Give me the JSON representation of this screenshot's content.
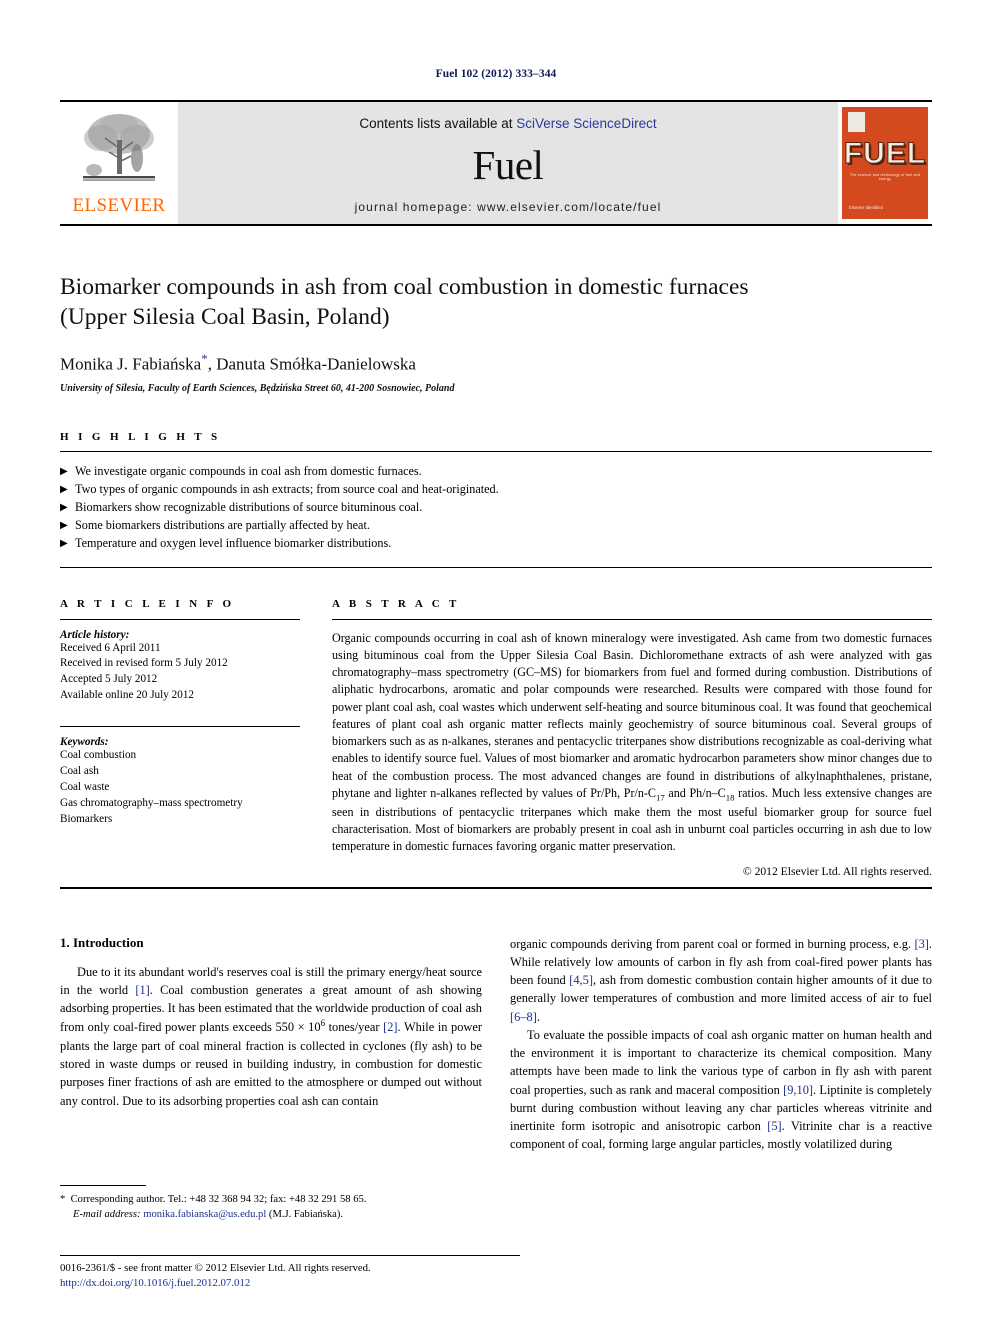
{
  "running_head": "Fuel 102 (2012) 333–344",
  "masthead": {
    "elsevier_wordmark": "ELSEVIER",
    "contents_prefix": "Contents lists available at ",
    "contents_link": "SciVerse ScienceDirect",
    "journal_name": "Fuel",
    "homepage": "journal homepage: www.elsevier.com/locate/fuel",
    "cover": {
      "title": "FUEL",
      "subtitle": "The science and technology of fuel and energy",
      "footer": "Elsevier Identified"
    }
  },
  "article": {
    "title_line1": "Biomarker compounds in ash from coal combustion in domestic furnaces",
    "title_line2": "(Upper Silesia Coal Basin, Poland)",
    "authors": "Monika J. Fabiańska",
    "authors_rest": ", Danuta Smółka-Danielowska",
    "corresponding_mark": "*",
    "affiliation": "University of Silesia, Faculty of Earth Sciences, Będzińska Street 60, 41-200 Sosnowiec, Poland"
  },
  "highlights": {
    "heading": "H I G H L I G H T S",
    "bullet_glyph": "▶",
    "items": [
      "We investigate organic compounds in coal ash from domestic furnaces.",
      "Two types of organic compounds in ash extracts; from source coal and heat-originated.",
      "Biomarkers show recognizable distributions of source bituminous coal.",
      "Some biomarkers distributions are partially affected by heat.",
      "Temperature and oxygen level influence biomarker distributions."
    ]
  },
  "article_info": {
    "heading": "A R T I C L E    I N F O",
    "history_label": "Article history:",
    "history": [
      "Received 6 April 2011",
      "Received in revised form 5 July 2012",
      "Accepted 5 July 2012",
      "Available online 20 July 2012"
    ],
    "keywords_label": "Keywords:",
    "keywords": [
      "Coal combustion",
      "Coal ash",
      "Coal waste",
      "Gas chromatography–mass spectrometry",
      "Biomarkers"
    ]
  },
  "abstract": {
    "heading": "A B S T R A C T",
    "part1": "Organic compounds occurring in coal ash of known mineralogy were investigated. Ash came from two domestic furnaces using bituminous coal from the Upper Silesia Coal Basin. Dichloromethane extracts of ash were analyzed with gas chromatography–mass spectrometry (GC–MS) for biomarkers from fuel and formed during combustion. Distributions of aliphatic hydrocarbons, aromatic and polar compounds were researched. Results were compared with those found for power plant coal ash, coal wastes which underwent self-heating and source bituminous coal. It was found that geochemical features of plant coal ash organic matter reflects mainly geochemistry of source bituminous coal. Several groups of biomarkers such as as n-alkanes, steranes and pentacyclic triterpanes show distributions recognizable as coal-deriving what enables to identify source fuel. Values of most biomarker and aromatic hydrocarbon parameters show minor changes due to heat of the combustion process. The most advanced changes are found in distributions of alkylnaphthalenes, pristane, phytane and lighter n-alkanes reflected by values of Pr/Ph, Pr/n-C",
    "sub1": "17",
    "part2": " and Ph/n–C",
    "sub2": "18",
    "part3": " ratios. Much less extensive changes are seen in distributions of pentacyclic triterpanes which make them the most useful biomarker group for source fuel characterisation. Most of biomarkers are probably present in coal ash in unburnt coal particles occurring in ash due to low temperature in domestic furnaces favoring organic matter preservation.",
    "copyright": "© 2012 Elsevier Ltd. All rights reserved."
  },
  "introduction": {
    "section_number_title": "1. Introduction",
    "left_p1_a": "Due to it its abundant world's reserves coal is still the primary energy/heat source in the world ",
    "left_p1_ref1": "[1]",
    "left_p1_b": ". Coal combustion generates a great amount of ash showing adsorbing properties. It has been estimated that the worldwide production of coal ash from only coal-fired power plants exceeds 550 × 10",
    "left_p1_sup": "6",
    "left_p1_c": " tones/year ",
    "left_p1_ref2": "[2]",
    "left_p1_d": ". While in power plants the large part of coal mineral fraction is collected in cyclones (fly ash) to be stored in waste dumps or reused in building industry, in combustion for domestic purposes finer fractions of ash are emitted to the atmosphere or dumped out without any control. Due to its adsorbing properties coal ash can contain",
    "right_p1_a": "organic compounds deriving from parent coal or formed in burning process, e.g. ",
    "right_p1_ref1": "[3]",
    "right_p1_b": ". While relatively low amounts of carbon in fly ash from coal-fired power plants has been found ",
    "right_p1_ref2": "[4,5]",
    "right_p1_c": ", ash from domestic combustion contain higher amounts of it due to generally lower temperatures of combustion and more limited access of air to fuel ",
    "right_p1_ref3": "[6–8]",
    "right_p1_d": ".",
    "right_p2_a": "To evaluate the possible impacts of coal ash organic matter on human health and the environment it is important to characterize its chemical composition. Many attempts have been made to link the various type of carbon in fly ash with parent coal properties, such as rank and maceral composition ",
    "right_p2_ref1": "[9,10]",
    "right_p2_b": ". Liptinite is completely burnt during combustion without leaving any char particles whereas vitrinite and inertinite form isotropic and anisotropic carbon ",
    "right_p2_ref2": "[5]",
    "right_p2_c": ". Vitrinite char is a reactive component of coal, forming large angular particles, mostly volatilized during"
  },
  "footnote": {
    "mark": "*",
    "line1": "Corresponding author. Tel.: +48 32 368 94 32; fax: +48 32 291 58 65.",
    "email_label": "E-mail address:",
    "email": "monika.fabianska@us.edu.pl",
    "email_suffix": " (M.J. Fabiańska)."
  },
  "page_footer": {
    "front_matter": "0016-2361/$ - see front matter © 2012 Elsevier Ltd. All rights reserved.",
    "doi": "http://dx.doi.org/10.1016/j.fuel.2012.07.012"
  },
  "colors": {
    "link_blue": "#1d2f8f",
    "elsevier_orange": "#ff6600",
    "cover_orange": "#d4491d",
    "masthead_gray": "#e4e4e4"
  }
}
